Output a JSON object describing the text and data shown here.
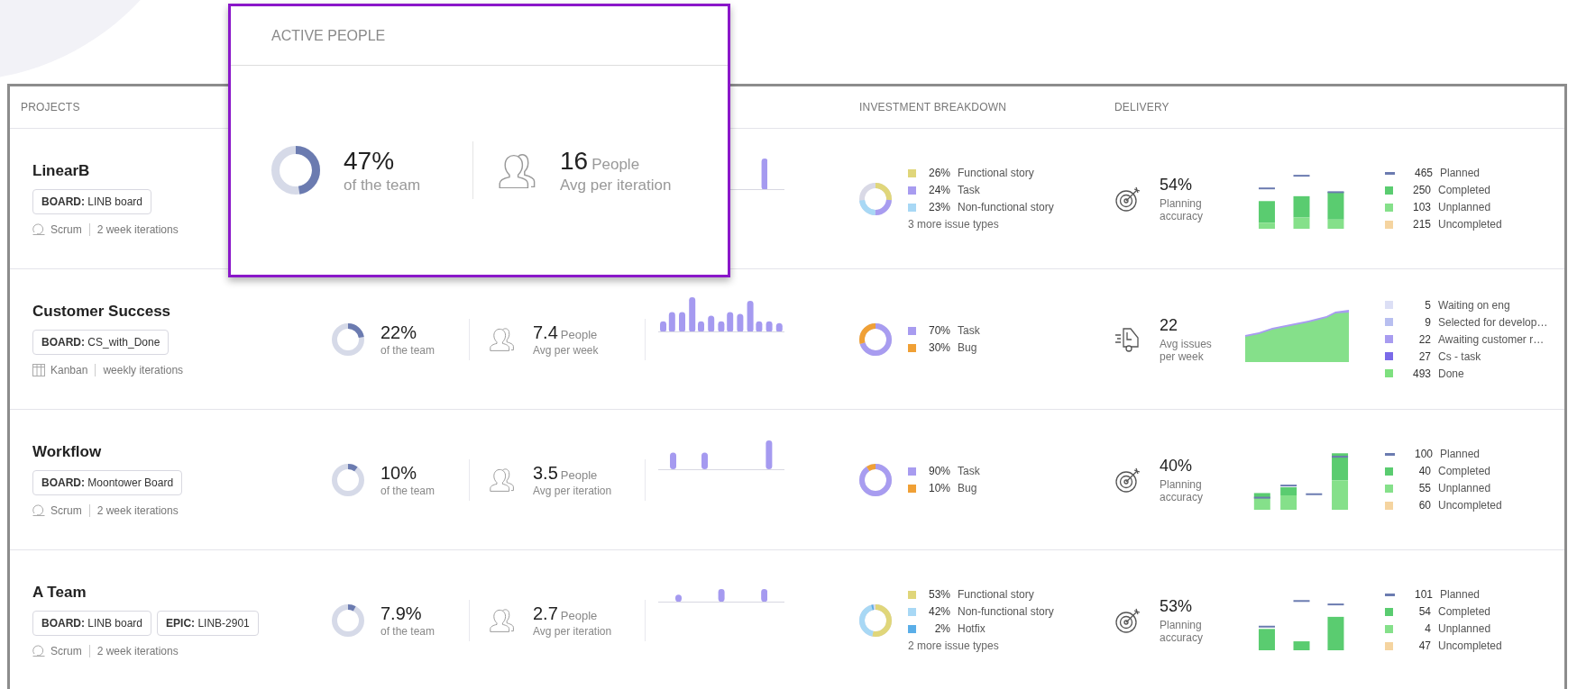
{
  "columns": [
    "PROJECTS",
    "INVESTMENT BREAKDOWN",
    "DELIVERY"
  ],
  "popup": {
    "title": "ACTIVE PEOPLE",
    "percent": "47%",
    "level": 0.47,
    "percent_label": "of the team",
    "people": "16",
    "people_unit": "People",
    "people_label": "Avg per iteration"
  },
  "rows": [
    {
      "name": "LinearB",
      "tags": [
        "**BOARD:** LINB board"
      ],
      "methodology": {
        "kind": "scrum",
        "label": "Scrum"
      },
      "cadence": "2 week iterations",
      "investment": {
        "items": [
          {
            "percent": "26%",
            "label": "Functional story",
            "color": "#e0d67a"
          },
          {
            "percent": "24%",
            "label": "Task",
            "color": "#a89cf0"
          },
          {
            "percent": "23%",
            "label": "Non-functional story",
            "color": "#a8d8f5"
          }
        ],
        "more": "3 more issue types"
      },
      "delivery": {
        "kind": "accuracy",
        "value": "54%",
        "label": "Planning accuracy",
        "legend": [
          {
            "kind": "line",
            "count": "465",
            "label": "Planned",
            "color": "#6b7bb0"
          },
          {
            "kind": "box",
            "count": "250",
            "label": "Completed",
            "color": "#5acc70"
          },
          {
            "kind": "box",
            "count": "103",
            "label": "Unplanned",
            "color": "#85e08a"
          },
          {
            "kind": "box",
            "count": "215",
            "label": "Uncompleted",
            "color": "#f5d4a0"
          }
        ]
      }
    },
    {
      "name": "Customer Success",
      "tags": [
        "**BOARD:** CS_with_Done"
      ],
      "methodology": {
        "kind": "kanban",
        "label": "Kanban"
      },
      "cadence": "weekly iterations",
      "active_people": {
        "percent": "22%",
        "level": 0.22,
        "percent_label": "of the team",
        "people": "7.4",
        "people_unit": "People",
        "people_label": "Avg per week"
      },
      "investment": {
        "items": [
          {
            "percent": "70%",
            "label": "Task",
            "color": "#a89cf0"
          },
          {
            "percent": "30%",
            "label": "Bug",
            "color": "#f0a035"
          }
        ]
      },
      "delivery": {
        "kind": "throughput",
        "value": "22",
        "label": "Avg issues per week",
        "legend": [
          {
            "kind": "box",
            "count": "5",
            "label": "Waiting on eng",
            "color": "#dcdff5"
          },
          {
            "kind": "box",
            "count": "9",
            "label": "Selected for develop…",
            "color": "#b8bff0"
          },
          {
            "kind": "box",
            "count": "22",
            "label": "Awaiting customer r…",
            "color": "#a89cf0"
          },
          {
            "kind": "box",
            "count": "27",
            "label": "Cs - task",
            "color": "#7a6ae8"
          },
          {
            "kind": "box",
            "count": "493",
            "label": "Done",
            "color": "#7ee07f"
          }
        ]
      }
    },
    {
      "name": "Workflow",
      "tags": [
        "**BOARD:** Moontower Board"
      ],
      "methodology": {
        "kind": "scrum",
        "label": "Scrum"
      },
      "cadence": "2 week iterations",
      "active_people": {
        "percent": "10%",
        "level": 0.1,
        "percent_label": "of the team",
        "people": "3.5",
        "people_unit": "People",
        "people_label": "Avg per iteration"
      },
      "investment": {
        "items": [
          {
            "percent": "90%",
            "label": "Task",
            "color": "#a89cf0"
          },
          {
            "percent": "10%",
            "label": "Bug",
            "color": "#f0a035"
          }
        ]
      },
      "delivery": {
        "kind": "accuracy",
        "value": "40%",
        "label": "Planning accuracy",
        "legend": [
          {
            "kind": "line",
            "count": "100",
            "label": "Planned",
            "color": "#6b7bb0"
          },
          {
            "kind": "box",
            "count": "40",
            "label": "Completed",
            "color": "#5acc70"
          },
          {
            "kind": "box",
            "count": "55",
            "label": "Unplanned",
            "color": "#85e08a"
          },
          {
            "kind": "box",
            "count": "60",
            "label": "Uncompleted",
            "color": "#f5d4a0"
          }
        ]
      }
    },
    {
      "name": "A Team",
      "tags": [
        "**BOARD:** LINB board",
        "**EPIC:** LINB-2901"
      ],
      "methodology": {
        "kind": "scrum",
        "label": "Scrum"
      },
      "cadence": "2 week iterations",
      "active_people": {
        "percent": "7.9%",
        "level": 0.079,
        "percent_label": "of the team",
        "people": "2.7",
        "people_unit": "People",
        "people_label": "Avg per iteration"
      },
      "investment": {
        "items": [
          {
            "percent": "53%",
            "label": "Functional story",
            "color": "#e0d67a"
          },
          {
            "percent": "42%",
            "label": "Non-functional story",
            "color": "#a8d8f5"
          },
          {
            "percent": "2%",
            "label": "Hotfix",
            "color": "#5aaee8"
          }
        ],
        "more": "2 more issue types"
      },
      "delivery": {
        "kind": "accuracy",
        "value": "53%",
        "label": "Planning accuracy",
        "legend": [
          {
            "kind": "line",
            "count": "101",
            "label": "Planned",
            "color": "#6b7bb0"
          },
          {
            "kind": "box",
            "count": "54",
            "label": "Completed",
            "color": "#5acc70"
          },
          {
            "kind": "box",
            "count": "4",
            "label": "Unplanned",
            "color": "#85e08a"
          },
          {
            "kind": "box",
            "count": "47",
            "label": "Uncompleted",
            "color": "#f5d4a0"
          }
        ]
      }
    }
  ]
}
